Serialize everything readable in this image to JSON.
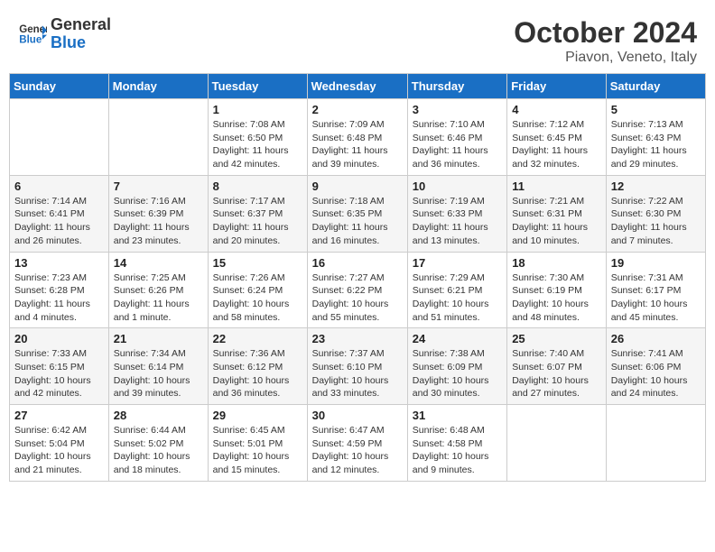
{
  "header": {
    "logo_line1": "General",
    "logo_line2": "Blue",
    "month": "October 2024",
    "location": "Piavon, Veneto, Italy"
  },
  "weekdays": [
    "Sunday",
    "Monday",
    "Tuesday",
    "Wednesday",
    "Thursday",
    "Friday",
    "Saturday"
  ],
  "weeks": [
    [
      {
        "day": "",
        "sunrise": "",
        "sunset": "",
        "daylight": ""
      },
      {
        "day": "",
        "sunrise": "",
        "sunset": "",
        "daylight": ""
      },
      {
        "day": "1",
        "sunrise": "Sunrise: 7:08 AM",
        "sunset": "Sunset: 6:50 PM",
        "daylight": "Daylight: 11 hours and 42 minutes."
      },
      {
        "day": "2",
        "sunrise": "Sunrise: 7:09 AM",
        "sunset": "Sunset: 6:48 PM",
        "daylight": "Daylight: 11 hours and 39 minutes."
      },
      {
        "day": "3",
        "sunrise": "Sunrise: 7:10 AM",
        "sunset": "Sunset: 6:46 PM",
        "daylight": "Daylight: 11 hours and 36 minutes."
      },
      {
        "day": "4",
        "sunrise": "Sunrise: 7:12 AM",
        "sunset": "Sunset: 6:45 PM",
        "daylight": "Daylight: 11 hours and 32 minutes."
      },
      {
        "day": "5",
        "sunrise": "Sunrise: 7:13 AM",
        "sunset": "Sunset: 6:43 PM",
        "daylight": "Daylight: 11 hours and 29 minutes."
      }
    ],
    [
      {
        "day": "6",
        "sunrise": "Sunrise: 7:14 AM",
        "sunset": "Sunset: 6:41 PM",
        "daylight": "Daylight: 11 hours and 26 minutes."
      },
      {
        "day": "7",
        "sunrise": "Sunrise: 7:16 AM",
        "sunset": "Sunset: 6:39 PM",
        "daylight": "Daylight: 11 hours and 23 minutes."
      },
      {
        "day": "8",
        "sunrise": "Sunrise: 7:17 AM",
        "sunset": "Sunset: 6:37 PM",
        "daylight": "Daylight: 11 hours and 20 minutes."
      },
      {
        "day": "9",
        "sunrise": "Sunrise: 7:18 AM",
        "sunset": "Sunset: 6:35 PM",
        "daylight": "Daylight: 11 hours and 16 minutes."
      },
      {
        "day": "10",
        "sunrise": "Sunrise: 7:19 AM",
        "sunset": "Sunset: 6:33 PM",
        "daylight": "Daylight: 11 hours and 13 minutes."
      },
      {
        "day": "11",
        "sunrise": "Sunrise: 7:21 AM",
        "sunset": "Sunset: 6:31 PM",
        "daylight": "Daylight: 11 hours and 10 minutes."
      },
      {
        "day": "12",
        "sunrise": "Sunrise: 7:22 AM",
        "sunset": "Sunset: 6:30 PM",
        "daylight": "Daylight: 11 hours and 7 minutes."
      }
    ],
    [
      {
        "day": "13",
        "sunrise": "Sunrise: 7:23 AM",
        "sunset": "Sunset: 6:28 PM",
        "daylight": "Daylight: 11 hours and 4 minutes."
      },
      {
        "day": "14",
        "sunrise": "Sunrise: 7:25 AM",
        "sunset": "Sunset: 6:26 PM",
        "daylight": "Daylight: 11 hours and 1 minute."
      },
      {
        "day": "15",
        "sunrise": "Sunrise: 7:26 AM",
        "sunset": "Sunset: 6:24 PM",
        "daylight": "Daylight: 10 hours and 58 minutes."
      },
      {
        "day": "16",
        "sunrise": "Sunrise: 7:27 AM",
        "sunset": "Sunset: 6:22 PM",
        "daylight": "Daylight: 10 hours and 55 minutes."
      },
      {
        "day": "17",
        "sunrise": "Sunrise: 7:29 AM",
        "sunset": "Sunset: 6:21 PM",
        "daylight": "Daylight: 10 hours and 51 minutes."
      },
      {
        "day": "18",
        "sunrise": "Sunrise: 7:30 AM",
        "sunset": "Sunset: 6:19 PM",
        "daylight": "Daylight: 10 hours and 48 minutes."
      },
      {
        "day": "19",
        "sunrise": "Sunrise: 7:31 AM",
        "sunset": "Sunset: 6:17 PM",
        "daylight": "Daylight: 10 hours and 45 minutes."
      }
    ],
    [
      {
        "day": "20",
        "sunrise": "Sunrise: 7:33 AM",
        "sunset": "Sunset: 6:15 PM",
        "daylight": "Daylight: 10 hours and 42 minutes."
      },
      {
        "day": "21",
        "sunrise": "Sunrise: 7:34 AM",
        "sunset": "Sunset: 6:14 PM",
        "daylight": "Daylight: 10 hours and 39 minutes."
      },
      {
        "day": "22",
        "sunrise": "Sunrise: 7:36 AM",
        "sunset": "Sunset: 6:12 PM",
        "daylight": "Daylight: 10 hours and 36 minutes."
      },
      {
        "day": "23",
        "sunrise": "Sunrise: 7:37 AM",
        "sunset": "Sunset: 6:10 PM",
        "daylight": "Daylight: 10 hours and 33 minutes."
      },
      {
        "day": "24",
        "sunrise": "Sunrise: 7:38 AM",
        "sunset": "Sunset: 6:09 PM",
        "daylight": "Daylight: 10 hours and 30 minutes."
      },
      {
        "day": "25",
        "sunrise": "Sunrise: 7:40 AM",
        "sunset": "Sunset: 6:07 PM",
        "daylight": "Daylight: 10 hours and 27 minutes."
      },
      {
        "day": "26",
        "sunrise": "Sunrise: 7:41 AM",
        "sunset": "Sunset: 6:06 PM",
        "daylight": "Daylight: 10 hours and 24 minutes."
      }
    ],
    [
      {
        "day": "27",
        "sunrise": "Sunrise: 6:42 AM",
        "sunset": "Sunset: 5:04 PM",
        "daylight": "Daylight: 10 hours and 21 minutes."
      },
      {
        "day": "28",
        "sunrise": "Sunrise: 6:44 AM",
        "sunset": "Sunset: 5:02 PM",
        "daylight": "Daylight: 10 hours and 18 minutes."
      },
      {
        "day": "29",
        "sunrise": "Sunrise: 6:45 AM",
        "sunset": "Sunset: 5:01 PM",
        "daylight": "Daylight: 10 hours and 15 minutes."
      },
      {
        "day": "30",
        "sunrise": "Sunrise: 6:47 AM",
        "sunset": "Sunset: 4:59 PM",
        "daylight": "Daylight: 10 hours and 12 minutes."
      },
      {
        "day": "31",
        "sunrise": "Sunrise: 6:48 AM",
        "sunset": "Sunset: 4:58 PM",
        "daylight": "Daylight: 10 hours and 9 minutes."
      },
      {
        "day": "",
        "sunrise": "",
        "sunset": "",
        "daylight": ""
      },
      {
        "day": "",
        "sunrise": "",
        "sunset": "",
        "daylight": ""
      }
    ]
  ]
}
